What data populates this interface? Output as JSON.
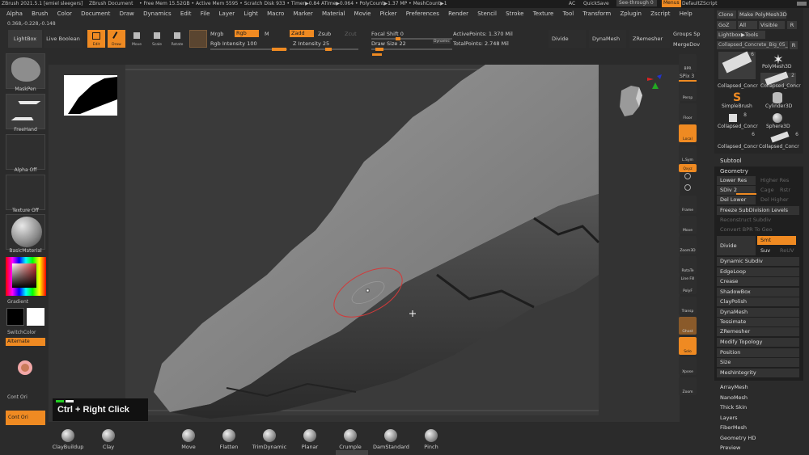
{
  "statusbar": {
    "app": "ZBrush 2021.5.1 [emiel sleegers]",
    "doc": "ZBrush Document",
    "stats": "• Free Mem 15.52GB • Active Mem 5595 • Scratch Disk 933 • Timer▶0.84 ATime▶0.064 • PolyCount▶1.37 MP • MeshCount▶1",
    "ac": "AC",
    "quicksave": "QuickSave",
    "seethrough": "See-through  0",
    "menus": "Menus",
    "script": "DefaultZScript"
  },
  "menubar": [
    "Alpha",
    "Brush",
    "Color",
    "Document",
    "Draw",
    "Dynamics",
    "Edit",
    "File",
    "Layer",
    "Light",
    "Macro",
    "Marker",
    "Material",
    "Movie",
    "Picker",
    "Preferences",
    "Render",
    "Stencil",
    "Stroke",
    "Texture",
    "Tool",
    "Transform",
    "Zplugin",
    "Zscript",
    "Help"
  ],
  "coords": "0.368,-0.228,-0.148",
  "toolbar": {
    "lightbox": "LightBox",
    "liveboolean": "Live Boolean",
    "edit": "Edit",
    "draw": "Draw",
    "move": "Move",
    "scale": "Scale",
    "rotate": "Rotate",
    "mrgb": "Mrgb",
    "rgb": "Rgb",
    "m": "M",
    "rgb_intensity": "Rgb Intensity 100",
    "zadd": "Zadd",
    "zsub": "Zsub",
    "zcut": "Zcut",
    "z_intensity": "Z Intensity 25",
    "focal_shift": "Focal Shift 0",
    "draw_size": "Draw Size 22",
    "dynamic": "Dynamic",
    "active_points": "ActivePoints: 1.370 Mil",
    "total_points": "TotalPoints: 2.748 Mil",
    "divide": "Divide",
    "dynamesh": "DynaMesh",
    "zremesher": "ZRemesher",
    "groups_split": "Groups Sp",
    "merge_down": "MergeDov"
  },
  "left": {
    "maskpen": "MaskPen",
    "freehand": "FreeHand",
    "alpha_off": "Alpha Off",
    "texture_off": "Texture Off",
    "basic_material": "BasicMaterial",
    "gradient": "Gradient",
    "switch_color": "SwitchColor",
    "alternate": "Alternate",
    "cont_ori": "Cont Ori",
    "cont_ori_on": "Cont Ori"
  },
  "hint": "Ctrl + Right Click",
  "rightshelf": {
    "bpr": "BPR",
    "spix": "SPix 3",
    "dynamic": "Dynamic",
    "persp": "Persp",
    "floor": "Floor",
    "local": "Local",
    "lsym": "L.Sym",
    "xyz": "Qxyz",
    "frame": "Frame",
    "move": "Move",
    "zoom3d": "Zoom3D",
    "rotate": "RotaTe",
    "line_fill": "Line Fill",
    "polyf": "PolyF",
    "transp": "Transp",
    "ghost": "Ghost",
    "solo": "Solo",
    "xpose": "Xpose",
    "zoom": "Zoom"
  },
  "tool": {
    "clone": "Clone",
    "make_polymesh": "Make PolyMesh3D",
    "goz": "GoZ",
    "all": "All",
    "visible": "Visible",
    "r": "R",
    "lightbox_tools": "Lightbox▶Tools",
    "current_tool": "Collapsed_Concrete_Big_05_1",
    "r2": "R",
    "thumbs": [
      {
        "label": "Collapsed_Concr",
        "count": "6"
      },
      {
        "label": "PolyMesh3D",
        "count": ""
      },
      {
        "label": "",
        "count": "2"
      },
      {
        "label": "SimpleBrush",
        "count": ""
      },
      {
        "label": "Cylinder3D",
        "count": ""
      },
      {
        "label": "Collapsed_Concr",
        "count": "8"
      },
      {
        "label": "Sphere3D",
        "count": ""
      },
      {
        "label": "Collapsed_Concr",
        "count": "6"
      },
      {
        "label": "Collapsed_Concr",
        "count": "6"
      }
    ]
  },
  "subtool": {
    "subtool": "Subtool",
    "geometry": "Geometry",
    "lower_res": "Lower Res",
    "higher_res": "Higher Res",
    "sdiv": "SDiv 2",
    "cage": "Cage",
    "rstr": "Rstr",
    "del_lower": "Del Lower",
    "del_higher": "Del Higher",
    "freeze": "Freeze SubDivision Levels",
    "reconstruct": "Reconstruct Subdiv",
    "convert_bpr": "Convert BPR To Geo",
    "divide": "Divide",
    "smt": "Smt",
    "suv": "Suv",
    "reuv": "ReUV",
    "items": [
      "Dynamic Subdiv",
      "EdgeLoop",
      "Crease",
      "ShadowBox",
      "ClayPolish",
      "DynaMesh",
      "Tessimate",
      "ZRemesher",
      "Modify Topology",
      "Position",
      "Size",
      "MeshIntegrity"
    ],
    "items2": [
      "ArrayMesh",
      "NanoMesh",
      "Thick Skin",
      "Layers",
      "FiberMesh",
      "Geometry HD",
      "Preview"
    ]
  },
  "brushes": [
    "ClayBuildup",
    "Clay",
    "Move",
    "Flatten",
    "TrimDynamic",
    "Planar",
    "Crumple",
    "DamStandard",
    "Pinch"
  ],
  "colors": {
    "accent": "#ef8a22",
    "bg": "#2b2b2b",
    "canvas": "#3b3b3b",
    "cursor_ring": "#d23a3a"
  }
}
